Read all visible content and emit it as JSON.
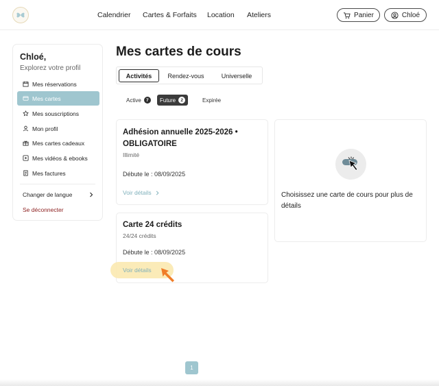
{
  "header": {
    "nav": [
      "Calendrier",
      "Cartes & Forfaits",
      "Location",
      "Ateliers"
    ],
    "cart_label": "Panier",
    "user_label": "Chloé"
  },
  "sidebar": {
    "greeting": "Chloé,",
    "subtitle": "Explorez votre profil",
    "items": [
      {
        "label": "Mes réservations",
        "icon": "calendar-icon"
      },
      {
        "label": "Mes cartes",
        "icon": "card-icon"
      },
      {
        "label": "Mes souscriptions",
        "icon": "star-icon"
      },
      {
        "label": "Mon profil",
        "icon": "user-icon"
      },
      {
        "label": "Mes cartes cadeaux",
        "icon": "gift-icon"
      },
      {
        "label": "Mes vidéos & ebooks",
        "icon": "video-icon"
      },
      {
        "label": "Mes factures",
        "icon": "invoice-icon"
      }
    ],
    "language_label": "Changer de langue",
    "logout_label": "Se déconnecter"
  },
  "main": {
    "title": "Mes cartes de cours",
    "tabs": [
      "Activités",
      "Rendez-vous",
      "Universelle"
    ],
    "filters": [
      {
        "label": "Active",
        "count": "7"
      },
      {
        "label": "Future",
        "count": "2"
      },
      {
        "label": "Expirée"
      }
    ],
    "cards": [
      {
        "title_line1": "Adhésion annuelle 2025-2026 •",
        "title_line2": "OBLIGATOIRE",
        "subtitle": "Illimité",
        "date": "Débute le : 08/09/2025",
        "link": "Voir détails"
      },
      {
        "title_line1": "Carte 24 crédits",
        "subtitle": "24/24 crédits",
        "date": "Débute le : 08/09/2025",
        "link": "Voir détails"
      }
    ],
    "detail_placeholder": "Choisissez une carte de cours pour plus de détails"
  },
  "pagination": {
    "current_page": "1"
  },
  "colors": {
    "accent": "#9fc6cf",
    "link": "#7fb0bb",
    "logout": "#8b1d1d",
    "highlight": "#fbe9b0",
    "cursor_arrow": "#f07d28"
  }
}
